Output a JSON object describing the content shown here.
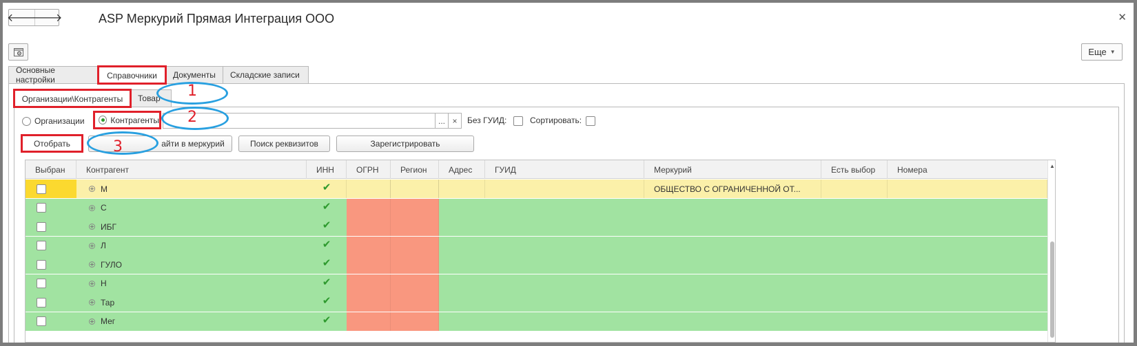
{
  "window": {
    "title": "ASP Меркурий Прямая Интеграция ООО",
    "more_label": "Еще"
  },
  "tabs": [
    {
      "label": "Основные настройки"
    },
    {
      "label": "Справочники"
    },
    {
      "label": "Документы"
    },
    {
      "label": "Складские записи"
    }
  ],
  "subtabs": [
    {
      "label": "Организации\\Контрагенты"
    },
    {
      "label": "Товар"
    }
  ],
  "filter": {
    "radio_org": "Организации",
    "radio_contr": "Контрагенты",
    "search_value": "",
    "select_btn": "...",
    "clear_btn": "×",
    "no_guid_label": "Без ГУИД:",
    "sort_label": "Сортировать:"
  },
  "buttons": {
    "select": "Отобрать",
    "find": "айти в меркурий",
    "search_req": "Поиск реквизитов",
    "register": "Зарегистрировать"
  },
  "table": {
    "columns": [
      "Выбран",
      "Контрагент",
      "ИНН",
      "ОГРН",
      "Регион",
      "Адрес",
      "ГУИД",
      "Меркурий",
      "Есть выбор",
      "Номера"
    ],
    "rows": [
      {
        "name": "М",
        "inn": "✔",
        "mercury": "ОБЩЕСТВО С ОГРАНИЧЕННОЙ ОТ...",
        "selected": true
      },
      {
        "name": "С",
        "inn": "✔",
        "mercury": "",
        "selected": false
      },
      {
        "name": "ИБГ",
        "inn": "✔",
        "mercury": "",
        "selected": false
      },
      {
        "name": "Л",
        "inn": "✔",
        "mercury": "",
        "selected": false
      },
      {
        "name": "ГУЛО",
        "inn": "✔",
        "mercury": "",
        "selected": false
      },
      {
        "name": "Н",
        "inn": "✔",
        "mercury": "",
        "selected": false
      },
      {
        "name": "Тар",
        "inn": "✔",
        "mercury": "",
        "selected": false
      },
      {
        "name": "Мег",
        "inn": "✔",
        "mercury": "",
        "selected": false
      }
    ]
  },
  "annotations": [
    "1",
    "2",
    "3"
  ],
  "colors": {
    "row_green": "#a1e3a1",
    "row_selected": "#fbf0a9",
    "cell_red": "#f9977f",
    "cell_yellow": "#fbd92f",
    "highlight_red": "#e0202a",
    "highlight_blue": "#29a0e0",
    "check_green": "#2e9a2e"
  },
  "icons": {
    "back": "arrow-left-icon",
    "forward": "arrow-right-icon",
    "close": "close-icon",
    "settings": "settings-icon",
    "expand": "plus-circle-icon",
    "check": "checkmark-icon",
    "dropdown": "caret-down-icon"
  }
}
